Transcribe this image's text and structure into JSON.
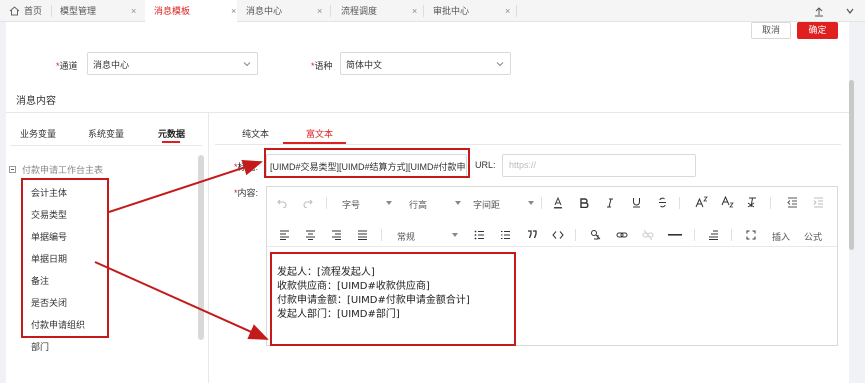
{
  "tabs": [
    {
      "label": "首页"
    },
    {
      "label": "模型管理"
    },
    {
      "label": "消息模板"
    },
    {
      "label": "消息中心"
    },
    {
      "label": "流程调度"
    },
    {
      "label": "审批中心"
    }
  ],
  "tab_close_glyph": "×",
  "actions": {
    "cancel": "取消",
    "confirm": "确定"
  },
  "form": {
    "channel_label": "通道",
    "channel_value": "消息中心",
    "language_label": "语种",
    "language_value": "简体中文",
    "required_mark": "*"
  },
  "section_title": "消息内容",
  "left_tabs": [
    "业务变量",
    "系统变量",
    "元数据"
  ],
  "tree": {
    "minus_glyph": "−",
    "root": "付款申请工作台主表",
    "items": [
      "会计主体",
      "交易类型",
      "单据编号",
      "单据日期",
      "备注",
      "是否关闭",
      "付款申请组织",
      "部门"
    ]
  },
  "right_tabs": [
    "纯文本",
    "富文本"
  ],
  "title_field": {
    "label": "标题:",
    "value": "[UIMD#交易类型][UIMD#结算方式][UIMD#付款申请",
    "url_label": "URL:",
    "url_placeholder": "https://"
  },
  "content_label": "内容:",
  "toolbar": {
    "font_size": "字号",
    "line_height": "行高",
    "letter_spacing": "字间距",
    "paragraph": "常规",
    "insert": "插入",
    "formula": "公式",
    "icons": [
      "undo-icon",
      "redo-icon",
      "font-color-icon",
      "bold-icon",
      "italic-icon",
      "underline-icon",
      "strikethrough-icon",
      "superscript-icon",
      "subscript-icon",
      "clear-format-icon",
      "indent-decrease-icon",
      "indent-increase-icon",
      "align-left-icon",
      "align-center-icon",
      "align-right-icon",
      "align-justify-icon",
      "ordered-list-icon",
      "unordered-list-icon",
      "quote-icon",
      "code-icon",
      "emoji-icon",
      "link-icon",
      "unlink-icon",
      "horizontal-rule-icon",
      "clear-icon",
      "fullscreen-icon"
    ]
  },
  "content_lines": [
    "发起人：[流程发起人]",
    "收款供应商：[UIMD#收款供应商]",
    "付款申请金额：[UIMD#付款申请金额合计]",
    "发起人部门：[UIMD#部门]"
  ],
  "colors": {
    "accent": "#e02020",
    "annotation": "#c51a1a"
  }
}
